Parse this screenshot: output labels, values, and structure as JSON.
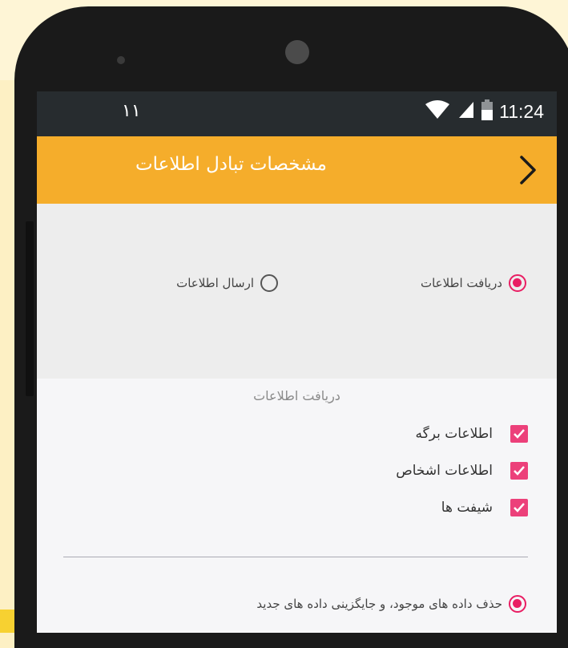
{
  "status_bar": {
    "left_indicator": "۱۱",
    "time": "11:24",
    "icons": [
      "wifi-icon",
      "cellular-icon",
      "battery-icon"
    ]
  },
  "app_bar": {
    "title": "مشخصات تبادل اطلاعات",
    "back_icon": "chevron-right-icon",
    "color": "#f5ad2b"
  },
  "mode": {
    "options": [
      {
        "label": "دریافت اطلاعات",
        "selected": true
      },
      {
        "label": "ارسال اطلاعات",
        "selected": false
      }
    ]
  },
  "receive_section": {
    "title": "دریافت اطلاعات",
    "items": [
      {
        "label": "اطلاعات برگه",
        "checked": true
      },
      {
        "label": "اطلاعات اشخاص",
        "checked": true
      },
      {
        "label": "شیفت ها",
        "checked": true
      }
    ]
  },
  "replace_option": {
    "label": "حذف داده های موجود، و جایگزینی داده های جدید",
    "selected": true
  },
  "colors": {
    "accent": "#e91e63",
    "checkbox": "#ec407a",
    "status_bar": "#272c2f"
  }
}
